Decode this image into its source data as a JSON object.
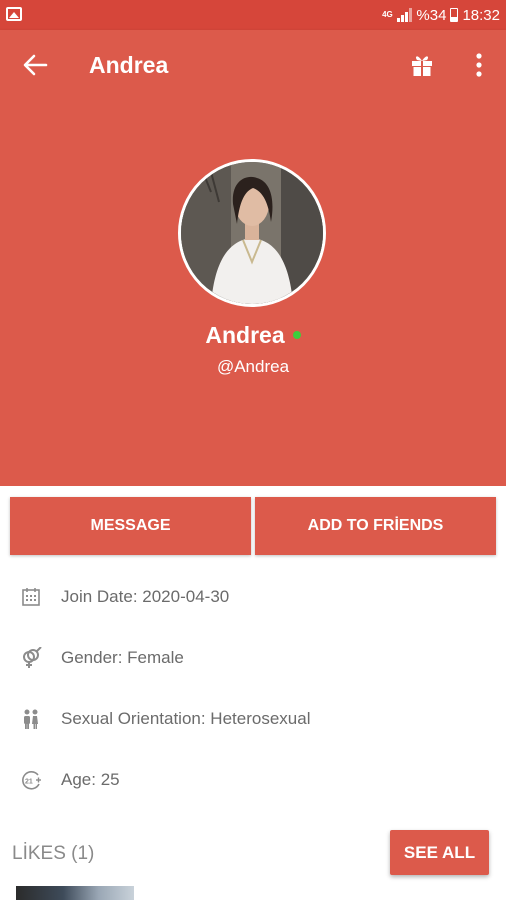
{
  "status_bar": {
    "network": "4G",
    "battery_percent": "%34",
    "time": "18:32"
  },
  "app_bar": {
    "title": "Andrea"
  },
  "profile": {
    "name": "Andrea",
    "username": "@Andrea",
    "online": true
  },
  "actions": {
    "message_label": "MESSAGE",
    "add_friends_label": "ADD TO FRİENDS"
  },
  "info": {
    "join_date": "Join Date: 2020-04-30",
    "gender": "Gender: Female",
    "orientation": "Sexual Orientation: Heterosexual",
    "age": "Age: 25"
  },
  "likes": {
    "label": "LİKES (1)",
    "see_all_label": "SEE ALL"
  },
  "colors": {
    "primary": "#dc5a4b",
    "status_bar": "#d6463a",
    "online": "#3ccf3c",
    "icon_grey": "#8c8c8c"
  }
}
